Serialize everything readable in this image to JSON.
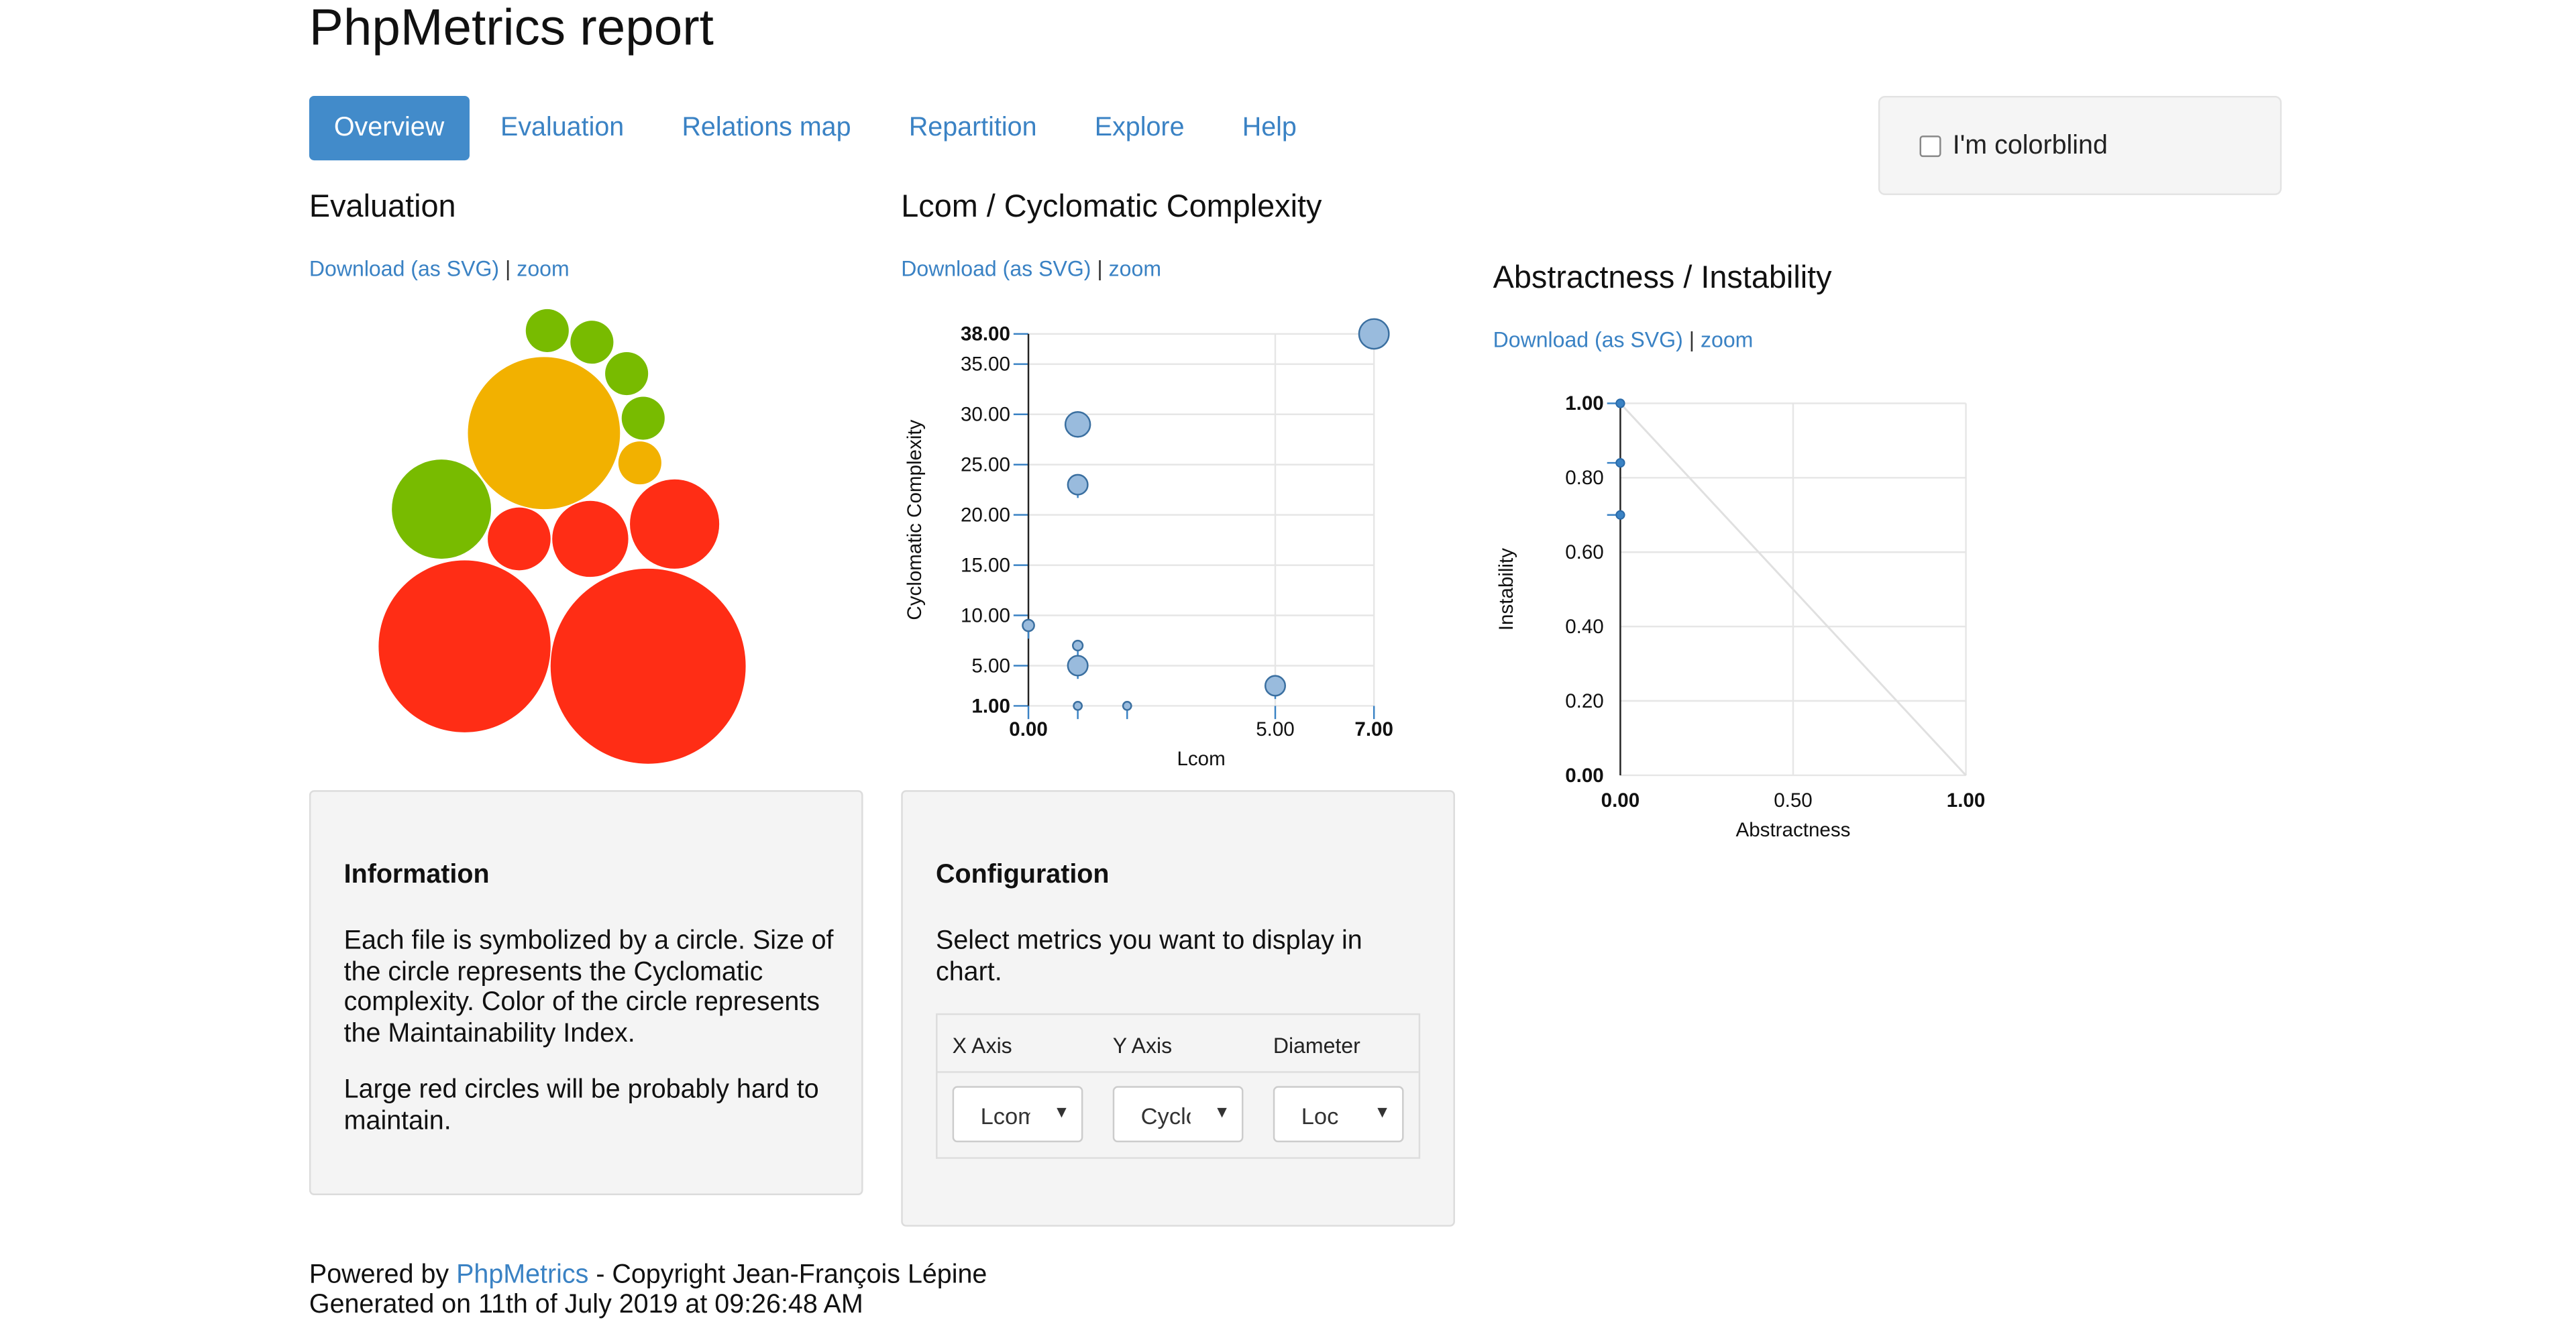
{
  "title": "PhpMetrics report",
  "nav": [
    {
      "label": "Overview",
      "active": true
    },
    {
      "label": "Evaluation",
      "active": false
    },
    {
      "label": "Relations map",
      "active": false
    },
    {
      "label": "Repartition",
      "active": false
    },
    {
      "label": "Explore",
      "active": false
    },
    {
      "label": "Help",
      "active": false
    }
  ],
  "colorblind": {
    "label": "I'm colorblind",
    "checked": false
  },
  "download_link": "Download (as SVG)",
  "separator": "|",
  "zoom_link": "zoom",
  "evaluation": {
    "title": "Evaluation",
    "colors": {
      "good": "#78bb00",
      "medium": "#f2b100",
      "bad": "#ff2d15"
    }
  },
  "lcom_chart": {
    "title": "Lcom / Cyclomatic Complexity",
    "chart_data": {
      "type": "scatter",
      "xlabel": "Lcom",
      "ylabel": "Cyclomatic Complexity",
      "xlim": [
        0,
        7
      ],
      "ylim": [
        1,
        38
      ],
      "x_ticks": [
        "0.00",
        "5.00",
        "7.00"
      ],
      "y_ticks": [
        "1.00",
        "5.00",
        "10.00",
        "15.00",
        "20.00",
        "25.00",
        "30.00",
        "35.00",
        "38.00"
      ],
      "points": [
        {
          "x": 7,
          "y": 38
        },
        {
          "x": 1,
          "y": 29
        },
        {
          "x": 1,
          "y": 23
        },
        {
          "x": 0,
          "y": 9
        },
        {
          "x": 1,
          "y": 7
        },
        {
          "x": 1,
          "y": 5
        },
        {
          "x": 5,
          "y": 3
        },
        {
          "x": 1,
          "y": 1
        },
        {
          "x": 2,
          "y": 1
        }
      ],
      "color": "#99bbdd"
    }
  },
  "abstract_chart": {
    "title": "Abstractness / Instability",
    "chart_data": {
      "type": "scatter",
      "xlabel": "Abstractness",
      "ylabel": "Instability",
      "xlim": [
        0,
        1
      ],
      "ylim": [
        0,
        1
      ],
      "x_ticks": [
        "0.00",
        "0.50",
        "1.00"
      ],
      "y_ticks": [
        "0.00",
        "0.20",
        "0.40",
        "0.60",
        "0.80",
        "1.00"
      ],
      "points": [
        {
          "x": 0,
          "y": 1.0
        },
        {
          "x": 0,
          "y": 0.84
        },
        {
          "x": 0,
          "y": 0.7
        }
      ],
      "color": "#3a82c4"
    }
  },
  "information": {
    "title": "Information",
    "p1": "Each file is symbolized by a circle. Size of the circle represents the Cyclomatic complexity. Color of the circle represents the Maintainability Index.",
    "p2": "Large red circles will be probably hard to maintain."
  },
  "configuration": {
    "title": "Configuration",
    "text": "Select metrics you want to display in chart.",
    "headers": [
      "X Axis",
      "Y Axis",
      "Diameter"
    ],
    "values": [
      "Lcom",
      "Cyclomatic",
      "Loc"
    ]
  },
  "footer": {
    "powered_prefix": "Powered by ",
    "powered_link": "PhpMetrics",
    "powered_suffix": " - Copyright Jean-François Lépine",
    "generated": "Generated on 11th of July 2019 at 09:26:48 AM"
  }
}
